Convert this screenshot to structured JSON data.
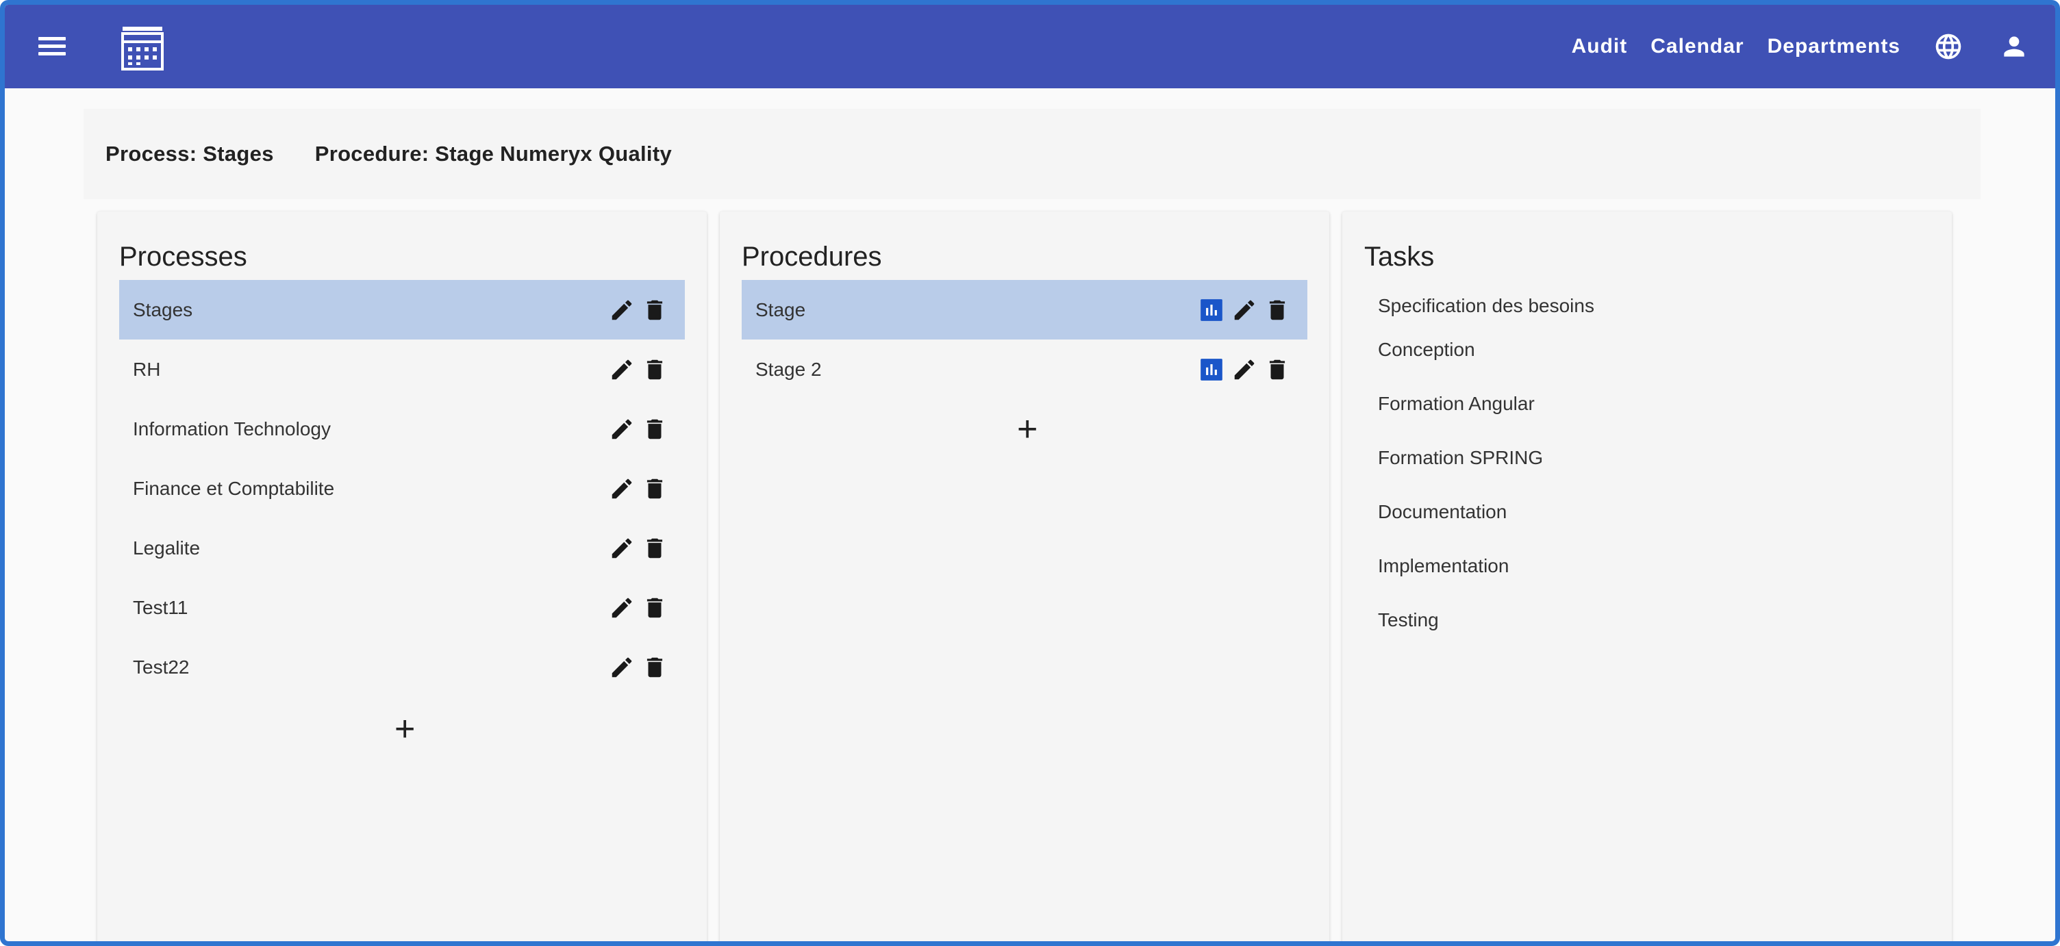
{
  "header": {
    "nav": [
      "Audit",
      "Calendar",
      "Departments"
    ],
    "icons": [
      "menu-icon",
      "app-logo-icon",
      "globe-icon",
      "account-icon"
    ]
  },
  "breadcrumb": {
    "process": "Process: Stages",
    "procedure": "Procedure: Stage Numeryx Quality"
  },
  "processes": {
    "title": "Processes",
    "items": [
      "Stages",
      "RH",
      "Information Technology",
      "Finance et Comptabilite",
      "Legalite",
      "Test11",
      "Test22"
    ],
    "selected_index": 0,
    "add_label": "+"
  },
  "procedures": {
    "title": "Procedures",
    "items": [
      "Stage",
      "Stage 2"
    ],
    "selected_index": 0,
    "add_label": "+"
  },
  "tasks": {
    "title": "Tasks",
    "items": [
      "Specification des besoins",
      "Conception",
      "Formation Angular",
      "Formation SPRING",
      "Documentation",
      "Implementation",
      "Testing"
    ]
  },
  "colors": {
    "toolbar": "#3f51b5",
    "selected_row": "#b9cce9",
    "chart_icon": "#1a56c9",
    "frame_border": "#2f75d0"
  }
}
